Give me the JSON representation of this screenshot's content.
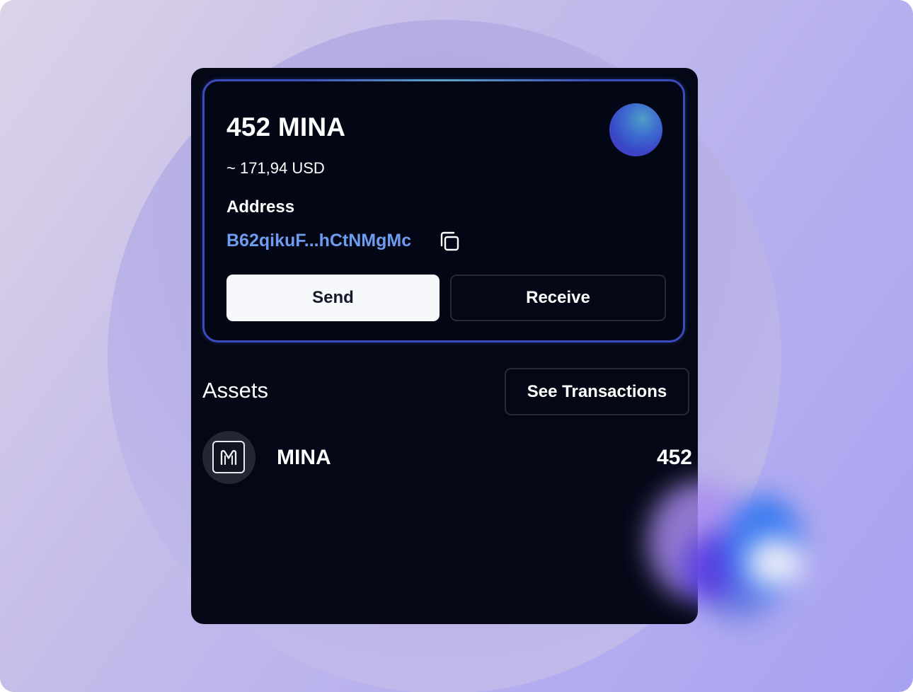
{
  "wallet": {
    "balance": "452 MINA",
    "fiat_value": "~ 171,94 USD",
    "address_label": "Address",
    "address": "B62qikuF...hCtNMgMc",
    "send_label": "Send",
    "receive_label": "Receive"
  },
  "assets": {
    "title": "Assets",
    "see_transactions_label": "See Transactions",
    "items": [
      {
        "name": "MINA",
        "amount": "452",
        "icon": "mina-logo-icon"
      }
    ]
  },
  "colors": {
    "panel_background": "#040816",
    "card_border": "#3a4bbd",
    "address_link": "#6e9df0",
    "send_button_background": "#f7f8fb"
  }
}
